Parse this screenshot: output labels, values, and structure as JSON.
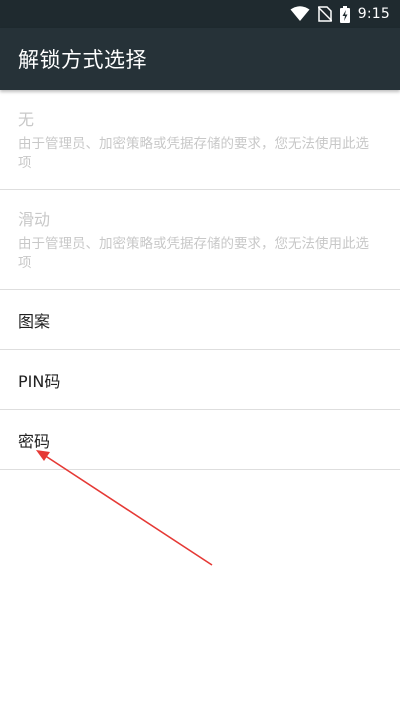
{
  "status_bar": {
    "time": "9:15",
    "icons": [
      "wifi-icon",
      "no-sim-icon",
      "battery-charging-icon"
    ]
  },
  "app_bar": {
    "title": "解锁方式选择"
  },
  "options": [
    {
      "title": "无",
      "summary": "由于管理员、加密策略或凭据存储的要求，您无法使用此选项",
      "enabled": false
    },
    {
      "title": "滑动",
      "summary": "由于管理员、加密策略或凭据存储的要求，您无法使用此选项",
      "enabled": false
    },
    {
      "title": "图案",
      "enabled": true
    },
    {
      "title": "PIN码",
      "enabled": true
    },
    {
      "title": "密码",
      "enabled": true
    }
  ],
  "annotation": {
    "color": "#e53935",
    "points_to": "密码"
  }
}
